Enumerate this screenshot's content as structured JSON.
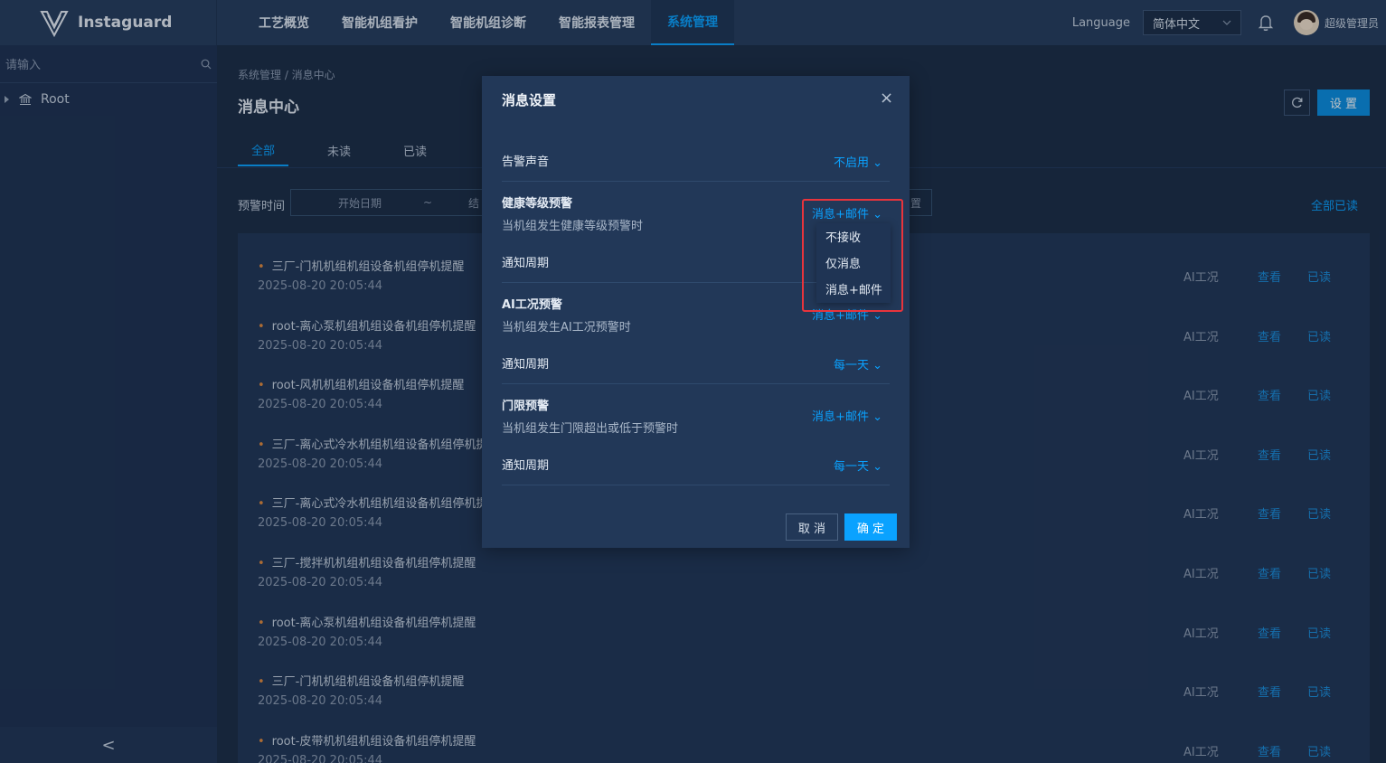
{
  "app": {
    "name": "Instaguard"
  },
  "nav": {
    "items": [
      {
        "label": "工艺概览"
      },
      {
        "label": "智能机组看护"
      },
      {
        "label": "智能机组诊断"
      },
      {
        "label": "智能报表管理"
      },
      {
        "label": "系统管理"
      }
    ],
    "language_label": "Language",
    "language_value": "简体中文",
    "user_name": "超级管理员"
  },
  "sidebar": {
    "search_placeholder": "请输入",
    "tree": [
      {
        "label": "Root"
      }
    ],
    "collapse_glyph": "<"
  },
  "page": {
    "breadcrumb": "系统管理  /  消息中心",
    "title": "消息中心",
    "settings_label": "设 置",
    "tabs": [
      {
        "label": "全部"
      },
      {
        "label": "未读"
      },
      {
        "label": "已读"
      }
    ],
    "filter_label": "预警时间",
    "start_placeholder": "开始日期",
    "range_sep": "~",
    "end_placeholder_partial": "结",
    "reset_partial": "置",
    "all_read_label": "全部已读"
  },
  "messages": [
    {
      "title": "三厂-门机机组机组设备机组停机提醒",
      "time": "2025-08-20 20:05:44",
      "type": "AI工况",
      "view": "查看",
      "read": "已读"
    },
    {
      "title": "root-离心泵机组机组设备机组停机提醒",
      "time": "2025-08-20 20:05:44",
      "type": "AI工况",
      "view": "查看",
      "read": "已读"
    },
    {
      "title": "root-风机机组机组设备机组停机提醒",
      "time": "2025-08-20 20:05:44",
      "type": "AI工况",
      "view": "查看",
      "read": "已读"
    },
    {
      "title": "三厂-离心式冷水机组机组设备机组停机提",
      "time": "2025-08-20 20:05:44",
      "type": "AI工况",
      "view": "查看",
      "read": "已读"
    },
    {
      "title": "三厂-离心式冷水机组机组设备机组停机提",
      "time": "2025-08-20 20:05:44",
      "type": "AI工况",
      "view": "查看",
      "read": "已读"
    },
    {
      "title": "三厂-搅拌机机组机组设备机组停机提醒",
      "time": "2025-08-20 20:05:44",
      "type": "AI工况",
      "view": "查看",
      "read": "已读"
    },
    {
      "title": "root-离心泵机组机组设备机组停机提醒",
      "time": "2025-08-20 20:05:44",
      "type": "AI工况",
      "view": "查看",
      "read": "已读"
    },
    {
      "title": "三厂-门机机组机组设备机组停机提醒",
      "time": "2025-08-20 20:05:44",
      "type": "AI工况",
      "view": "查看",
      "read": "已读"
    },
    {
      "title": "root-皮带机机组机组设备机组停机提醒",
      "time": "2025-08-20 20:05:44",
      "type": "AI工况",
      "view": "查看",
      "read": "已读"
    }
  ],
  "modal": {
    "title": "消息设置",
    "close_glyph": "×",
    "alarm_sound": {
      "label": "告警声音",
      "value": "不启用"
    },
    "health": {
      "label": "健康等级预警",
      "sub": "当机组发生健康等级预警时",
      "value": "消息+邮件",
      "cycle_label": "通知周期"
    },
    "ai": {
      "label": "AI工况预警",
      "sub": "当机组发生AI工况预警时",
      "value": "消息+邮件",
      "cycle_label": "通知周期",
      "cycle_value": "每一天"
    },
    "threshold": {
      "label": "门限预警",
      "sub": "当机组发生门限超出或低于预警时",
      "value": "消息+邮件",
      "cycle_label": "通知周期",
      "cycle_value": "每一天"
    },
    "cancel_label": "取 消",
    "ok_label": "确 定"
  },
  "dropdown": {
    "options": [
      {
        "label": "不接收"
      },
      {
        "label": "仅消息"
      },
      {
        "label": "消息+邮件"
      }
    ]
  },
  "colors": {
    "accent": "#0aa2ff",
    "highlight": "#e8343c",
    "dot": "#e28a3c"
  }
}
